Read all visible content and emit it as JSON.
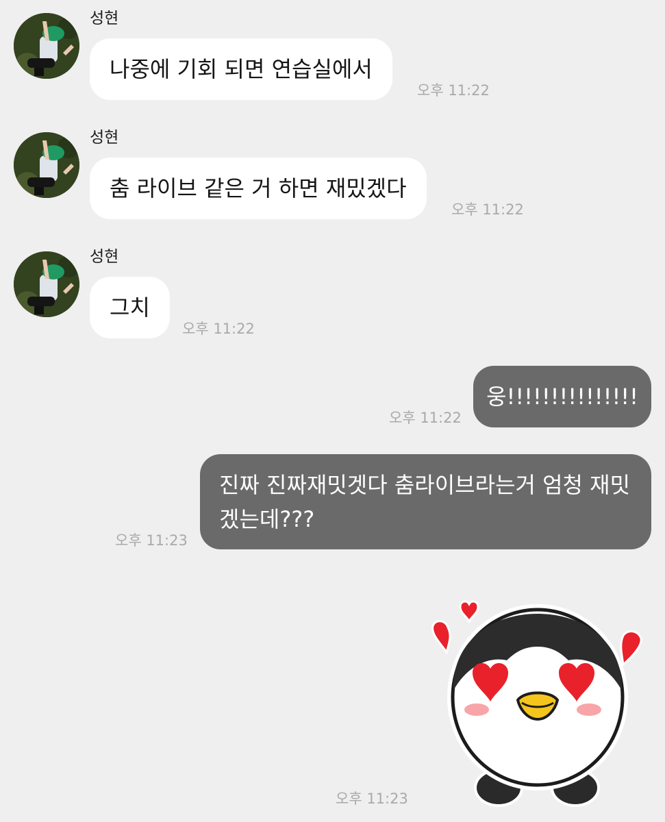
{
  "messages": [
    {
      "direction": "in",
      "sender": "성현",
      "text": "나중에 기회 되면 연습실에서",
      "time": "오후 11:22"
    },
    {
      "direction": "in",
      "sender": "성현",
      "text": "춤 라이브 같은 거 하면 재밌겠다",
      "time": "오후 11:22"
    },
    {
      "direction": "in",
      "sender": "성현",
      "text": "그치",
      "time": "오후 11:22"
    },
    {
      "direction": "out",
      "text": "웅!!!!!!!!!!!!!!!",
      "time": "오후 11:22"
    },
    {
      "direction": "out",
      "text": "진짜 진짜재밋겟다 춤라이브라는거 엄청 재밋겠는데???",
      "time": "오후 11:23"
    },
    {
      "direction": "out",
      "sticker": "penguin-heart-eyes-sticker",
      "time": "오후 11:23"
    }
  ],
  "colors": {
    "background": "#efefef",
    "incoming_bubble": "#ffffff",
    "outgoing_bubble": "#6a6a6a",
    "timestamp": "#a9a9a9",
    "heart": "#e8212a"
  }
}
